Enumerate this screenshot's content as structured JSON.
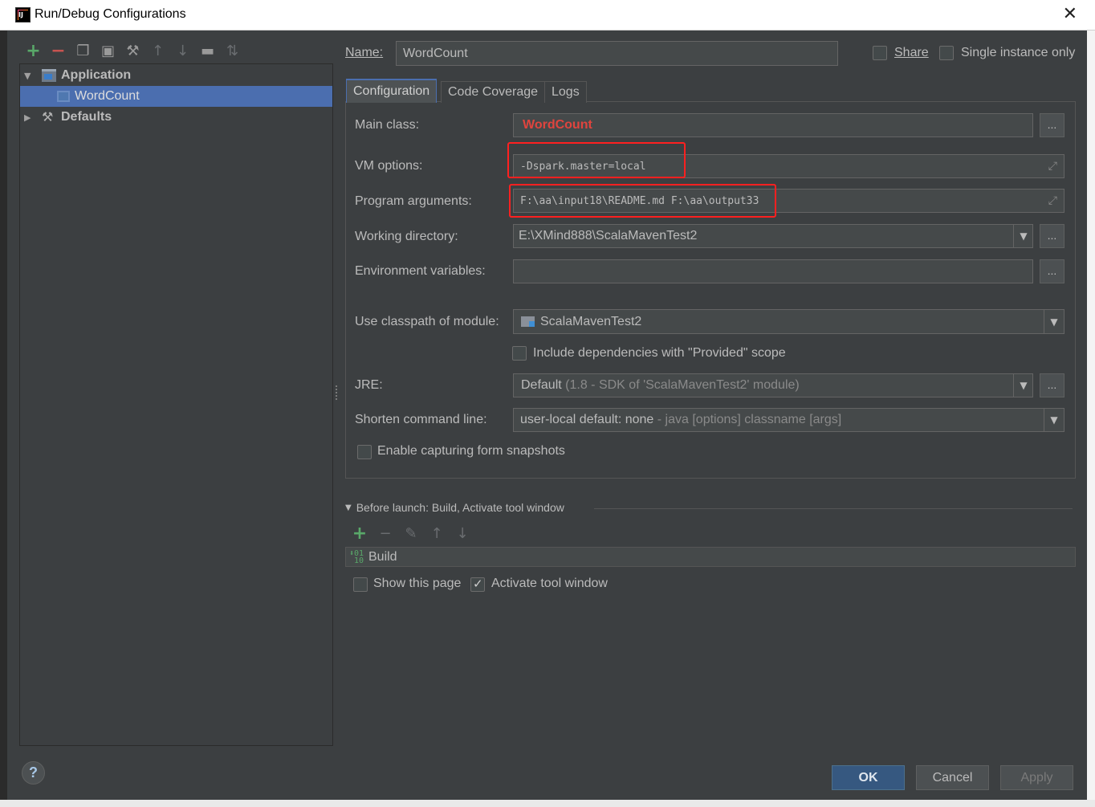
{
  "window": {
    "title": "Run/Debug Configurations",
    "close_icon": "close-icon"
  },
  "left_toolbar": {
    "icons": [
      "add-icon",
      "remove-icon",
      "copy-icon",
      "save-icon",
      "wrench-icon",
      "move-up-icon",
      "move-down-icon",
      "folder-icon",
      "sort-icon"
    ]
  },
  "tree": {
    "items": [
      {
        "label": "Application",
        "expanded": true
      },
      {
        "label": "WordCount",
        "selected": true
      },
      {
        "label": "Defaults",
        "expanded": false
      }
    ]
  },
  "header": {
    "name_label": "Name:",
    "name_value": "WordCount",
    "share_label": "Share",
    "share_checked": false,
    "single_instance_label": "Single instance only",
    "single_instance_checked": false
  },
  "tabs": [
    {
      "label": "Configuration",
      "active": true
    },
    {
      "label": "Code Coverage",
      "active": false
    },
    {
      "label": "Logs",
      "active": false
    }
  ],
  "config": {
    "main_class_label": "Main class:",
    "main_class_value": "WordCount",
    "vm_options_label": "VM options:",
    "vm_options_value": "-Dspark.master=local",
    "program_args_label": "Program arguments:",
    "program_args_value": "F:\\aa\\input18\\README.md F:\\aa\\output33",
    "working_dir_label": "Working directory:",
    "working_dir_value": "E:\\XMind888\\ScalaMavenTest2",
    "env_vars_label": "Environment variables:",
    "env_vars_value": "",
    "classpath_label": "Use classpath of module:",
    "classpath_value": "ScalaMavenTest2",
    "include_deps_label": "Include dependencies with \"Provided\" scope",
    "include_deps_checked": false,
    "jre_label": "JRE:",
    "jre_value": "Default",
    "jre_hint": "(1.8 - SDK of 'ScalaMavenTest2' module)",
    "shorten_label": "Shorten command line:",
    "shorten_value": "user-local default: none",
    "shorten_hint": "- java [options] classname [args]",
    "snapshots_label": "Enable capturing form snapshots",
    "snapshots_checked": false,
    "ellipsis": "..."
  },
  "before_launch": {
    "header": "Before launch: Build, Activate tool window",
    "toolbar_icons": [
      "add-icon",
      "remove-icon",
      "edit-icon",
      "move-up-icon",
      "move-down-icon"
    ],
    "tasks": [
      "Build"
    ],
    "show_page_label": "Show this page",
    "show_page_checked": false,
    "activate_label": "Activate tool window",
    "activate_checked": true
  },
  "buttons": {
    "ok": "OK",
    "cancel": "Cancel",
    "apply": "Apply",
    "help": "?"
  },
  "colors": {
    "background": "#3c3f41",
    "selection": "#4b6eaf",
    "error_text": "#e0443e",
    "highlight_box": "#ff2020",
    "primary_button": "#365880"
  }
}
